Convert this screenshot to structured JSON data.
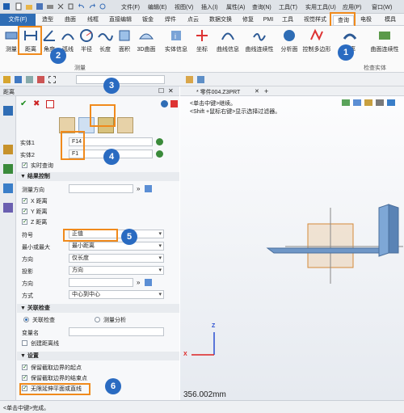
{
  "menubar": {
    "items": [
      "文件(F)",
      "编辑(E)",
      "视图(V)",
      "插入(I)",
      "属性(A)",
      "查询(N)",
      "工具(T)",
      "实用工具(U)",
      "应用(P)",
      "窗口(W)"
    ]
  },
  "tabs": [
    "文件(F)",
    "造型",
    "曲面",
    "线框",
    "直接编辑",
    "钣金",
    "焊件",
    "点云",
    "数据交换",
    "修复",
    "PMI",
    "工具",
    "视觉样式",
    "查询",
    "电极",
    "模具"
  ],
  "ribbon": {
    "buttons": [
      "测量",
      "距离",
      "角度",
      "弧线",
      "半径",
      "长度",
      "面积",
      "3D曲面",
      "实体信息",
      "坐标",
      "曲线信息",
      "曲线连续性",
      "分析面",
      "控制多边形",
      "曲率",
      "曲面连续性"
    ],
    "groups": {
      "measure": "测量",
      "check": "检查实体"
    }
  },
  "panel": {
    "title": "距离",
    "entity1_label": "实体1",
    "entity1_value": "F14",
    "entity2_label": "实体2",
    "entity2_value": "F1",
    "realtime": "实时查询",
    "result_section": "结果控制",
    "measure_dir": "测量方向",
    "x_dist": "X 距离",
    "y_dist": "Y 距离",
    "z_dist": "Z 距离",
    "sign_label": "符号",
    "sign_value": "正值",
    "minmax_label": "最小或最大",
    "minmax_value": "最小距离",
    "direction_label": "方向",
    "direction_value": "仅长度",
    "proj_label": "投影",
    "proj_value": "方向",
    "dir2_label": "方向",
    "mode_label": "方式",
    "mode_value": "中心到中心",
    "assoc_section": "关联检查",
    "assoc_check": "关联检查",
    "measure_analysis": "测量分析",
    "varname_label": "变量名",
    "create_distline": "创建距离线",
    "settings_section": "设置",
    "keep_start": "保留截取边界的起点",
    "keep_end": "保留截取边界的结束点",
    "infinite_ext": "无限延伸平面或直线"
  },
  "viewport": {
    "tab_label": "* 零件004.Z3PRT",
    "hint1": "<单击中键>继续。",
    "hint2": "<Shift +鼠标右键>显示选择过滤器。",
    "measure_readout": "356.002mm",
    "axis_x": "X",
    "axis_z": "Z"
  },
  "status": "<单击中键>完成。",
  "badges": [
    "1",
    "2",
    "3",
    "4",
    "5",
    "6"
  ]
}
